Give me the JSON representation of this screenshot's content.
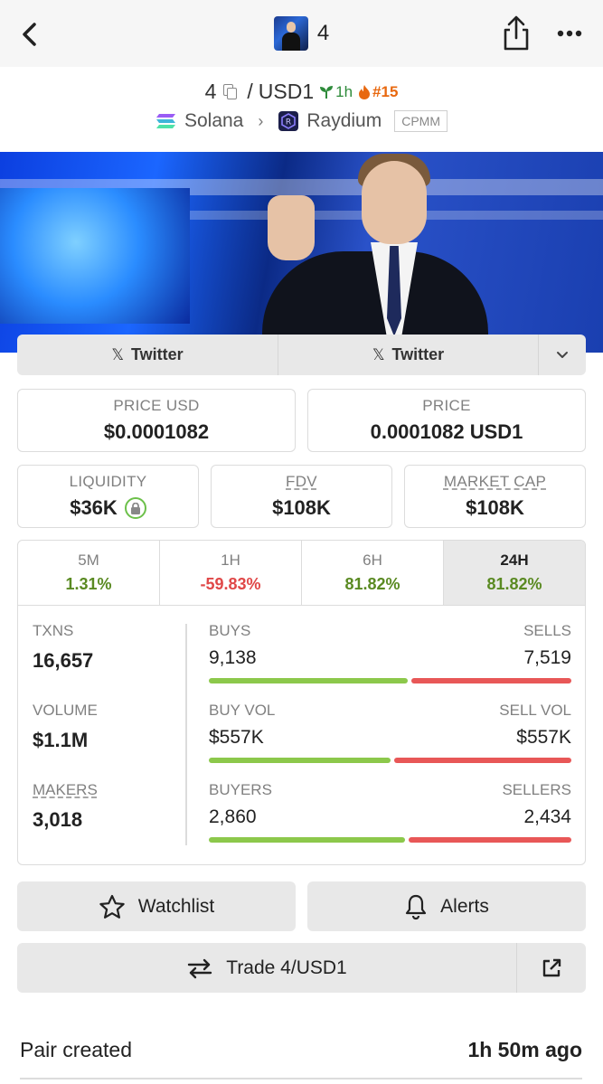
{
  "header": {
    "title": "4"
  },
  "pair": {
    "base": "4",
    "separator": "/",
    "quote": "USD1",
    "age": "1h",
    "rank": "#15"
  },
  "chain": {
    "network": "Solana",
    "dex": "Raydium",
    "pool_type": "CPMM"
  },
  "socials": [
    {
      "label": "Twitter"
    },
    {
      "label": "Twitter"
    }
  ],
  "prices": {
    "price_usd_label": "PRICE USD",
    "price_usd": "$0.0001082",
    "price_label": "PRICE",
    "price": "0.0001082 USD1"
  },
  "stats": {
    "liquidity_label": "LIQUIDITY",
    "liquidity": "$36K",
    "fdv_label": "FDV",
    "fdv": "$108K",
    "mcap_label": "MARKET CAP",
    "mcap": "$108K"
  },
  "timeframes": [
    {
      "label": "5M",
      "change": "1.31%",
      "sign": "pos"
    },
    {
      "label": "1H",
      "change": "-59.83%",
      "sign": "neg"
    },
    {
      "label": "6H",
      "change": "81.82%",
      "sign": "pos"
    },
    {
      "label": "24H",
      "change": "81.82%",
      "sign": "pos",
      "active": true
    }
  ],
  "metrics": [
    {
      "label": "TXNS",
      "value": "16,657"
    },
    {
      "label": "VOLUME",
      "value": "$1.1M"
    },
    {
      "label": "MAKERS",
      "value": "3,018"
    }
  ],
  "splits": [
    {
      "left_label": "BUYS",
      "left_value": "9,138",
      "right_label": "SELLS",
      "right_value": "7,519",
      "buy_share": 0.549
    },
    {
      "left_label": "BUY VOL",
      "left_value": "$557K",
      "right_label": "SELL VOL",
      "right_value": "$557K",
      "buy_share": 0.5
    },
    {
      "left_label": "BUYERS",
      "left_value": "2,860",
      "right_label": "SELLERS",
      "right_value": "2,434",
      "buy_share": 0.54
    }
  ],
  "actions": {
    "watchlist": "Watchlist",
    "alerts": "Alerts",
    "trade": "Trade 4/USD1"
  },
  "info": {
    "pair_created_label": "Pair created",
    "pair_created_value": "1h 50m ago"
  },
  "colors": {
    "positive": "#5a8a22",
    "negative": "#e04848",
    "buy_bar": "#8cc84b",
    "sell_bar": "#e85757",
    "age": "#2e8b3a",
    "rank": "#e8680f"
  }
}
